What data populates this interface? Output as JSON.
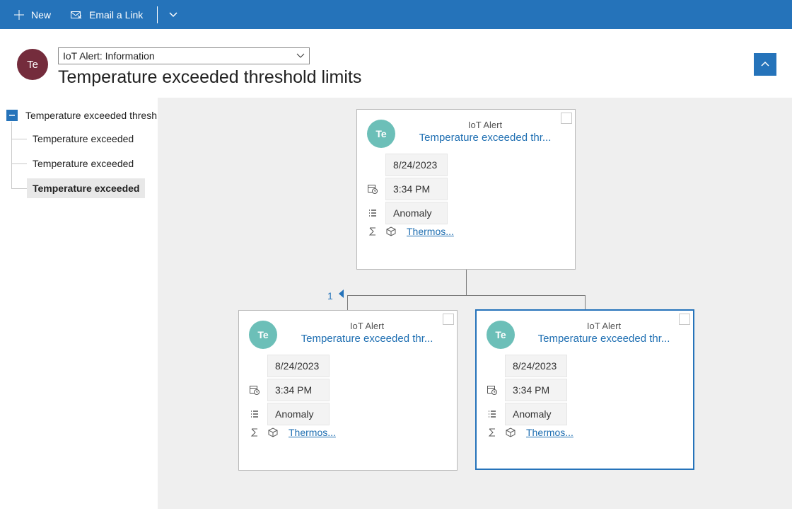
{
  "toolbar": {
    "new_label": "New",
    "email_label": "Email a Link"
  },
  "header": {
    "avatar_initials": "Te",
    "form_selector": "IoT Alert: Information",
    "title": "Temperature exceeded threshold limits"
  },
  "tree": {
    "root_label": "Temperature exceeded thresh",
    "children": [
      {
        "label": "Temperature exceeded",
        "selected": false
      },
      {
        "label": "Temperature exceeded",
        "selected": false
      },
      {
        "label": "Temperature exceeded",
        "selected": true
      }
    ]
  },
  "diagram": {
    "child_count": "1",
    "cards": [
      {
        "avatar": "Te",
        "type_label": "IoT Alert",
        "title": "Temperature exceeded thr...",
        "date": "8/24/2023",
        "time": "3:34 PM",
        "category": "Anomaly",
        "device_link": "Thermos..."
      },
      {
        "avatar": "Te",
        "type_label": "IoT Alert",
        "title": "Temperature exceeded thr...",
        "date": "8/24/2023",
        "time": "3:34 PM",
        "category": "Anomaly",
        "device_link": "Thermos..."
      },
      {
        "avatar": "Te",
        "type_label": "IoT Alert",
        "title": "Temperature exceeded thr...",
        "date": "8/24/2023",
        "time": "3:34 PM",
        "category": "Anomaly",
        "device_link": "Thermos..."
      }
    ]
  }
}
